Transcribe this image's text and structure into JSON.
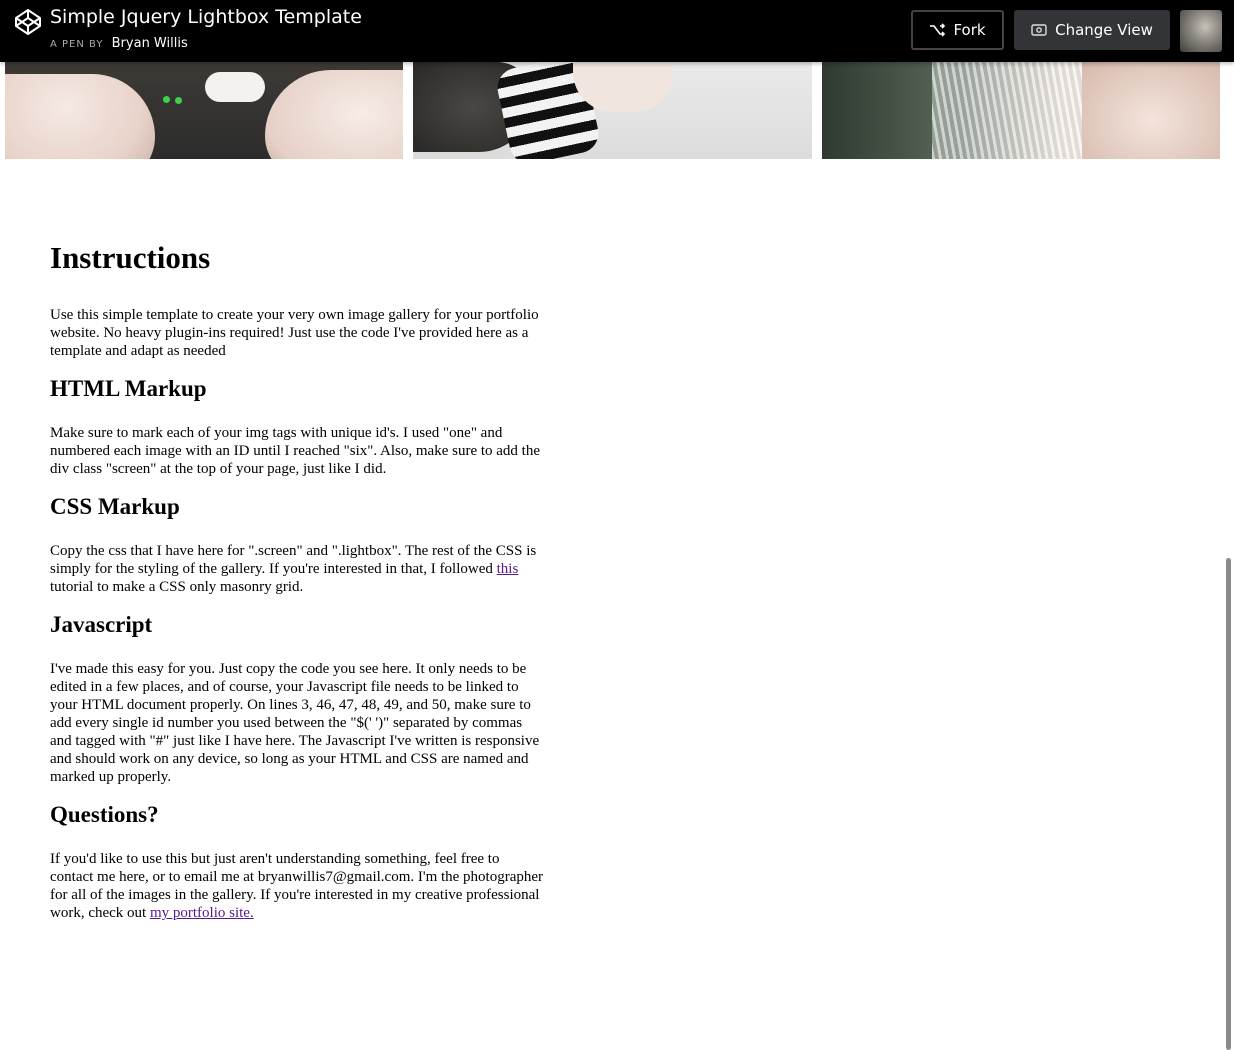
{
  "header": {
    "title": "Simple Jquery Lightbox Template",
    "byline_prefix": "A PEN BY",
    "author": "Bryan Willis",
    "fork_label": "Fork",
    "change_view_label": "Change View",
    "logo_icon": "codepen-logo-icon",
    "background": "#000000"
  },
  "content": {
    "title": "Instructions",
    "intro": "Use this simple template to create your very own image gallery for your portfolio website. No heavy plugin-ins required! Just use the code I've provided here as a template and adapt as needed",
    "html_heading": "HTML Markup",
    "html_text": "Make sure to mark each of your img tags with unique id's. I used \"one\" and numbered each image with an ID until I reached \"six\". Also, make sure to add the div class \"screen\" at the top of your page, just like I did.",
    "css_heading": "CSS Markup",
    "css_text_before": "Copy the css that I have here for \".screen\" and \".lightbox\". The rest of the CSS is simply for the styling of the gallery. If you're interested in that, I followed ",
    "css_link": "this",
    "css_text_after": " tutorial to make a CSS only masonry grid.",
    "js_heading": "Javascript",
    "js_text": "I've made this easy for you. Just copy the code you see here. It only needs to be edited in a few places, and of course, your Javascript file needs to be linked to your HTML document properly. On lines 3, 46, 47, 48, 49, and 50, make sure to add every single id number you used between the \"$(' ')\" separated by commas and tagged with \"#\" just like I have here. The Javascript I've written is responsive and should work on any device, so long as your HTML and CSS are named and marked up properly.",
    "questions_heading": "Questions?",
    "questions_text": "If you'd like to use this but just aren't understanding something, feel free to contact me here, or to email me at bryanwillis7@gmail.com. I'm the photographer for all of the images in the gallery. If you're interested in my creative professional work, check out ",
    "portfolio_link": "my portfolio site."
  },
  "colors": {
    "link": "#551a8b",
    "button_bg": "#333438"
  }
}
